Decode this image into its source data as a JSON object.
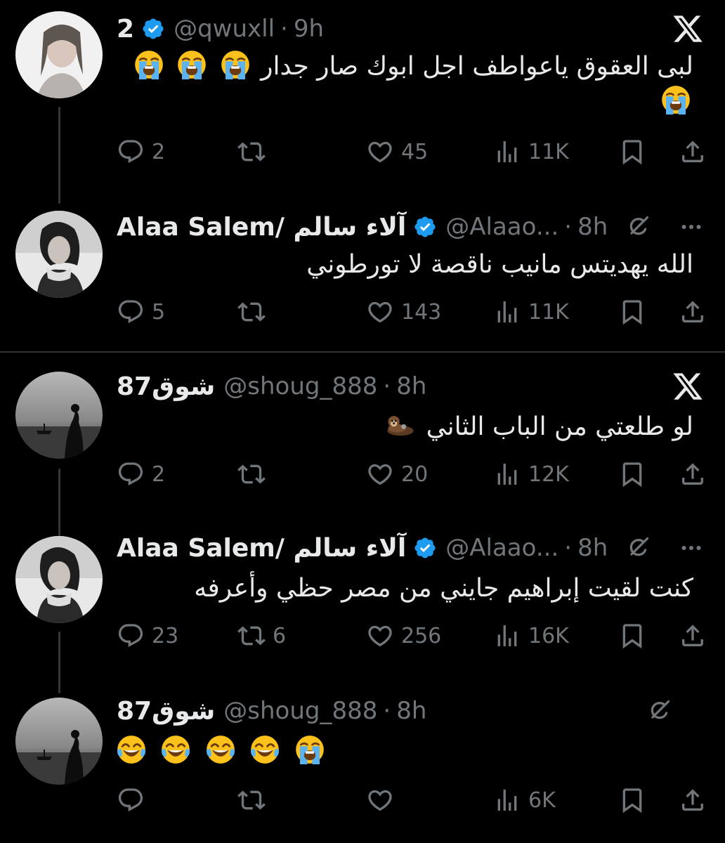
{
  "threads": [
    {
      "tweets": [
        {
          "name": "2",
          "verified": true,
          "handle": "@qwuxll",
          "separator": "·",
          "time": "9h",
          "text": "لبى العقوق ياعواطف اجل ابوك صار جدار",
          "emoji": [
            "loudly-crying-face",
            "loudly-crying-face",
            "loudly-crying-face",
            "loudly-crying-face"
          ],
          "replies": "2",
          "retweets": "",
          "likes": "45",
          "views": "11K",
          "header_icon": "x-logo-icon"
        },
        {
          "name": "Alaa Salem/ آلاء سالم",
          "verified": true,
          "handle": "@Alaao...",
          "separator": "·",
          "time": "8h",
          "text": "الله يهديتس مانيب ناقصة لا تورطوني",
          "emoji": [],
          "replies": "5",
          "retweets": "",
          "likes": "143",
          "views": "11K",
          "header_icon": "grok-icon"
        }
      ]
    },
    {
      "tweets": [
        {
          "name": "شوق87",
          "verified": false,
          "handle": "@shoug_888",
          "separator": "·",
          "time": "8h",
          "text": "لو طلعتي من الباب الثاني",
          "emoji": [
            "otter"
          ],
          "replies": "2",
          "retweets": "",
          "likes": "20",
          "views": "12K",
          "header_icon": "x-logo-icon"
        },
        {
          "name": "Alaa Salem/ آلاء سالم",
          "verified": true,
          "handle": "@Alaao...",
          "separator": "·",
          "time": "8h",
          "text": "كنت لقيت إبراهيم جايني من مصر حظي وأعرفه",
          "emoji": [],
          "replies": "23",
          "retweets": "6",
          "likes": "256",
          "views": "16K",
          "header_icon": "grok-icon"
        },
        {
          "name": "شوق87",
          "verified": false,
          "handle": "@shoug_888",
          "separator": "·",
          "time": "8h",
          "text": "",
          "emoji": [
            "face-with-tears-of-joy",
            "face-with-tears-of-joy",
            "face-with-tears-of-joy",
            "face-with-tears-of-joy",
            "loudly-crying-face"
          ],
          "replies": "",
          "retweets": "",
          "likes": "",
          "views": "6K",
          "header_icon": "grok-icon"
        }
      ]
    }
  ],
  "colors": {
    "background": "#000000",
    "text": "#e7e9ea",
    "muted": "#71767b",
    "verified": "#1d9bf0",
    "divider": "#2f3336"
  }
}
